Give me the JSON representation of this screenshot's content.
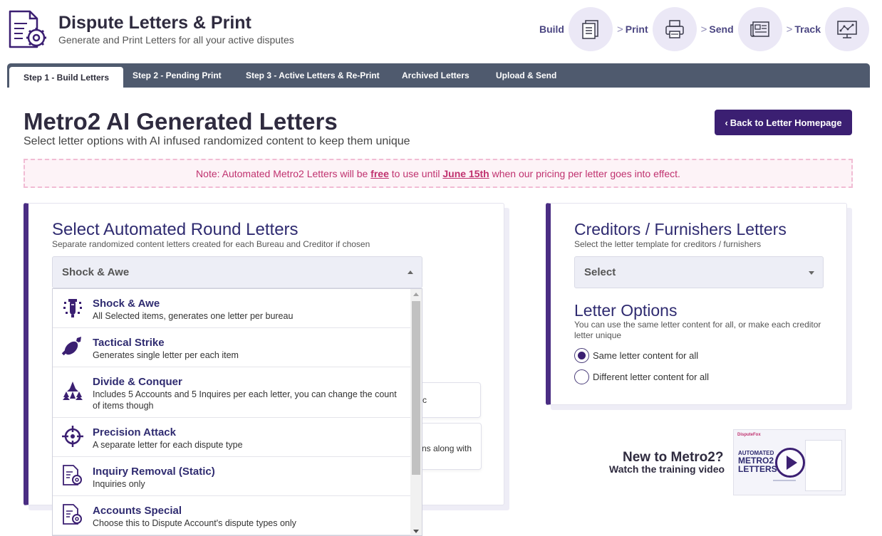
{
  "header": {
    "title": "Dispute Letters & Print",
    "subtitle": "Generate and Print Letters for all your active disputes"
  },
  "steps": [
    {
      "label": "Build",
      "icon": "document-list-icon"
    },
    {
      "label": "Print",
      "icon": "printer-icon"
    },
    {
      "label": "Send",
      "icon": "newspaper-icon"
    },
    {
      "label": "Track",
      "icon": "monitor-chart-icon"
    }
  ],
  "step_separator": ">",
  "tabs": [
    {
      "label": "Step 1 - Build Letters",
      "active": true
    },
    {
      "label": "Step 2 - Pending Print",
      "active": false
    },
    {
      "label": "Step 3 - Active Letters & Re-Print",
      "active": false
    },
    {
      "label": "Archived Letters",
      "active": false
    },
    {
      "label": "Upload & Send",
      "active": false
    }
  ],
  "page": {
    "title": "Metro2 AI Generated Letters",
    "subtitle": "Select letter options with AI infused randomized content to keep them unique",
    "back_button": "Back to Letter Homepage"
  },
  "note": {
    "prefix": "Note: Automated Metro2 Letters will be ",
    "free": "free",
    "middle": " to use until ",
    "date": "June 15th",
    "suffix": " when our pricing per letter goes into effect."
  },
  "round_letters": {
    "title": "Select Automated Round Letters",
    "subtitle": "Separate randomized content letters created for each Bureau and Creditor if chosen",
    "selected": "Shock & Awe",
    "hidden_partial_1": "c",
    "hidden_partial_2": "ns along with",
    "options": [
      {
        "title": "Shock & Awe",
        "desc": "All Selected items, generates one letter per bureau",
        "icon": "bomb-icon"
      },
      {
        "title": "Tactical Strike",
        "desc": "Generates single letter per each item",
        "icon": "missile-icon"
      },
      {
        "title": "Divide & Conquer",
        "desc": "Includes 5 Accounts and 5 Inquires per each letter, you can change the count of items though",
        "icon": "jets-formation-icon"
      },
      {
        "title": "Precision Attack",
        "desc": "A separate letter for each dispute type",
        "icon": "crosshair-icon"
      },
      {
        "title": "Inquiry Removal (Static)",
        "desc": "Inquiries only",
        "icon": "document-gear-icon"
      },
      {
        "title": "Accounts Special",
        "desc": "Choose this to Dispute Account's dispute types only",
        "icon": "document-gear-icon"
      }
    ]
  },
  "creditors": {
    "title": "Creditors / Furnishers Letters",
    "subtitle": "Select the letter template for creditors / furnishers",
    "select_placeholder": "Select"
  },
  "letter_options": {
    "title": "Letter Options",
    "desc": "You can use the same letter content for all, or make each creditor letter unique",
    "options": [
      {
        "label": "Same letter content for all",
        "checked": true
      },
      {
        "label": "Different letter content for all",
        "checked": false
      }
    ]
  },
  "promo": {
    "title": "New to Metro2?",
    "subtitle": "Watch the training video",
    "thumb_brand": "DisputeFox",
    "thumb_line1": "AUTOMATED",
    "thumb_line2": "METRO2",
    "thumb_line3": "LETTERS"
  },
  "colors": {
    "brand_purple": "#3b1f72",
    "tab_bar": "#4f5a6e",
    "note_pink": "#c0326f",
    "card_accent": "#4a2d83"
  }
}
